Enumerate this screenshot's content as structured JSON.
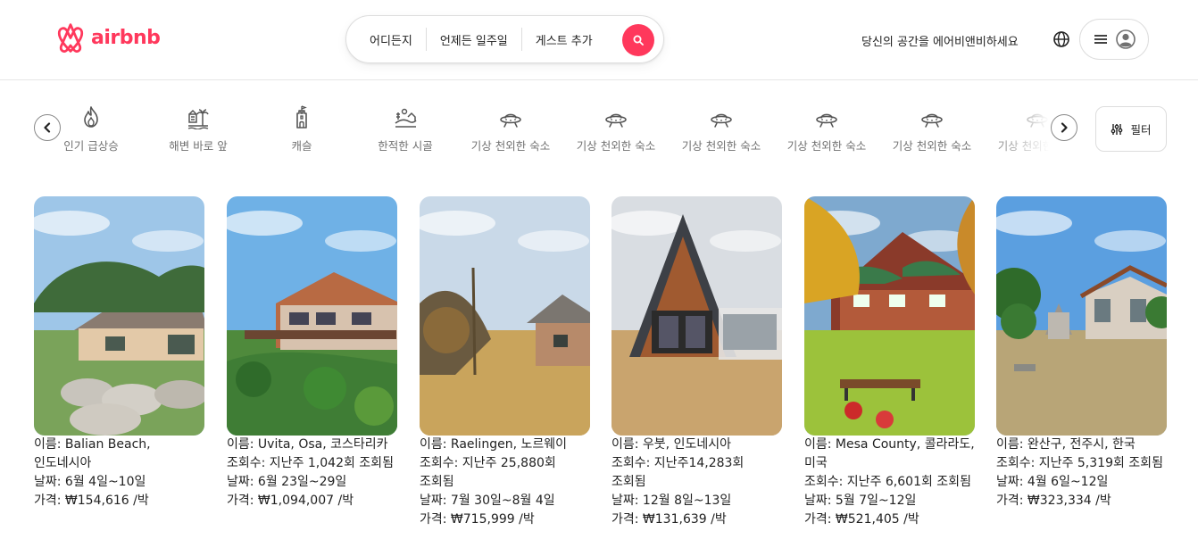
{
  "brand": {
    "name": "airbnb",
    "color": "#ff385c"
  },
  "search": {
    "where": "어디든지",
    "when": "언제든 일주일",
    "guests": "게스트 추가",
    "button_icon": "search-icon"
  },
  "header": {
    "host_link": "당신의 공간을 에어비앤비하세요",
    "globe_icon": "globe-icon",
    "menu_icon": "hamburger-icon",
    "avatar_icon": "user-avatar-icon"
  },
  "categories": [
    {
      "label": "인기 급상승",
      "icon": "flame-icon"
    },
    {
      "label": "해변 바로 앞",
      "icon": "beach-icon"
    },
    {
      "label": "캐슬",
      "icon": "castle-icon"
    },
    {
      "label": "한적한 시골",
      "icon": "countryside-icon"
    },
    {
      "label": "기상 천외한 숙소",
      "icon": "ufo-icon"
    },
    {
      "label": "기상 천외한 숙소",
      "icon": "ufo-icon"
    },
    {
      "label": "기상 천외한 숙소",
      "icon": "ufo-icon"
    },
    {
      "label": "기상 천외한 숙소",
      "icon": "ufo-icon"
    },
    {
      "label": "기상 천외한 숙소",
      "icon": "ufo-icon"
    },
    {
      "label": "기상 천외한 숙소",
      "icon": "ufo-icon"
    }
  ],
  "filter": {
    "label": "필터",
    "icon": "sliders-icon"
  },
  "listings": [
    {
      "name": "이름: Balian Beach, 인도네시아",
      "views": "",
      "dates": "날짜: 6월 4일~10일",
      "price": "가격: ₩154,616 /박"
    },
    {
      "name": "이름: Uvita, Osa, 코스타리카",
      "views": "조회수: 지난주 1,042회 조회됨",
      "dates": "날짜: 6월 23일~29일",
      "price": "가격: ₩1,094,007 /박"
    },
    {
      "name": "이름: Raelingen, 노르웨이",
      "views": "조회수: 지난주 25,880회 조회됨",
      "dates": "날짜: 7월 30일~8월 4일",
      "price": "가격: ₩715,999 /박"
    },
    {
      "name": "이름: 우붓, 인도네시아",
      "views": "조회수: 지난주14,283회 조회됨",
      "dates": "날짜: 12월 8일~13일",
      "price": "가격: ₩131,639 /박"
    },
    {
      "name": "이름: Mesa County, 콜라라도, 미국",
      "views": "조회수: 지난주 6,601회 조회됨",
      "dates": "날짜: 5월 7일~12일",
      "price": "가격: ₩521,405 /박"
    },
    {
      "name": "이름: 완산구, 전주시, 한국",
      "views": "조회수: 지난주 5,319회 조회됨",
      "dates": "날짜: 4월 6일~12일",
      "price": "가격: ₩323,334 /박"
    }
  ]
}
